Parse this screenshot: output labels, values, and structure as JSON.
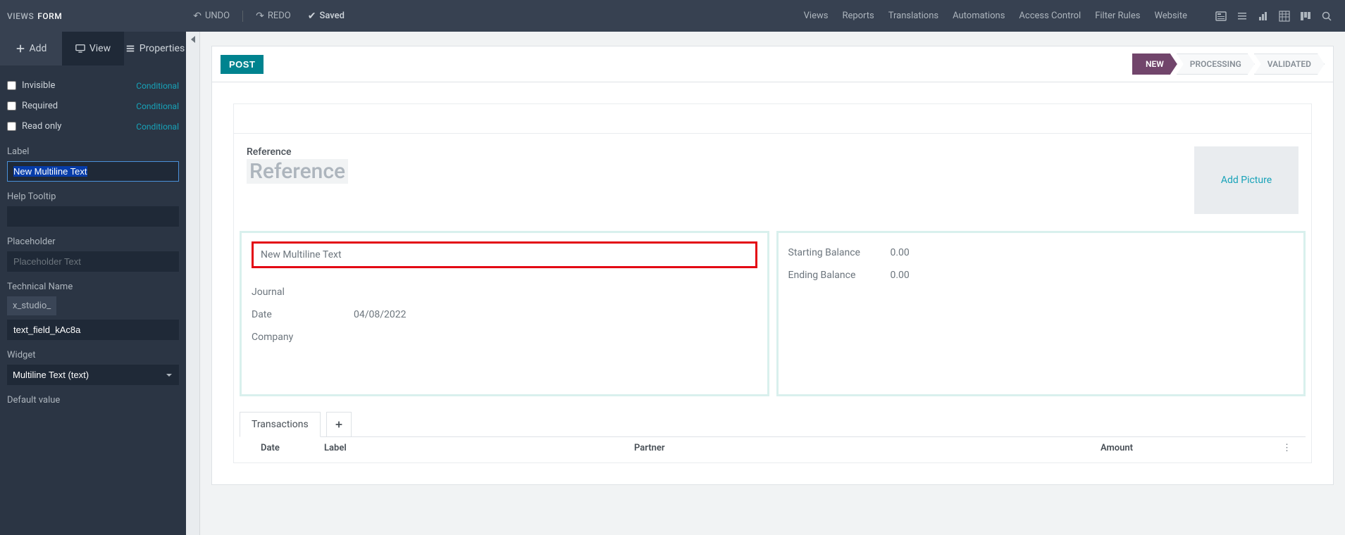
{
  "topbar": {
    "breadcrumb1": "VIEWS",
    "breadcrumb2": "FORM",
    "undo": "UNDO",
    "redo": "REDO",
    "saved": "Saved",
    "links": [
      "Views",
      "Reports",
      "Translations",
      "Automations",
      "Access Control",
      "Filter Rules",
      "Website"
    ]
  },
  "sidebar": {
    "tabs": {
      "add": "Add",
      "view": "View",
      "properties": "Properties"
    },
    "checks": {
      "invisible": "Invisible",
      "required": "Required",
      "readonly": "Read only",
      "conditional": "Conditional"
    },
    "label_lbl": "Label",
    "label_val": "New Multiline Text",
    "help_lbl": "Help Tooltip",
    "help_val": "",
    "placeholder_lbl": "Placeholder",
    "placeholder_hint": "Placeholder Text",
    "tech_lbl": "Technical Name",
    "tech_prefix": "x_studio_",
    "tech_val": "text_field_kAc8a",
    "widget_lbl": "Widget",
    "widget_val": "Multiline Text (text)",
    "default_lbl": "Default value"
  },
  "form": {
    "post": "POST",
    "status": {
      "new": "NEW",
      "processing": "PROCESSING",
      "validated": "VALIDATED"
    },
    "reference_lbl": "Reference",
    "reference_placeholder": "Reference",
    "picture": "Add Picture",
    "new_field": "New Multiline Text",
    "journal": "Journal",
    "date_lbl": "Date",
    "date_val": "04/08/2022",
    "company": "Company",
    "start_bal_lbl": "Starting Balance",
    "start_bal_val": "0.00",
    "end_bal_lbl": "Ending Balance",
    "end_bal_val": "0.00",
    "tab_trans": "Transactions",
    "cols": {
      "date": "Date",
      "label": "Label",
      "partner": "Partner",
      "amount": "Amount"
    }
  }
}
